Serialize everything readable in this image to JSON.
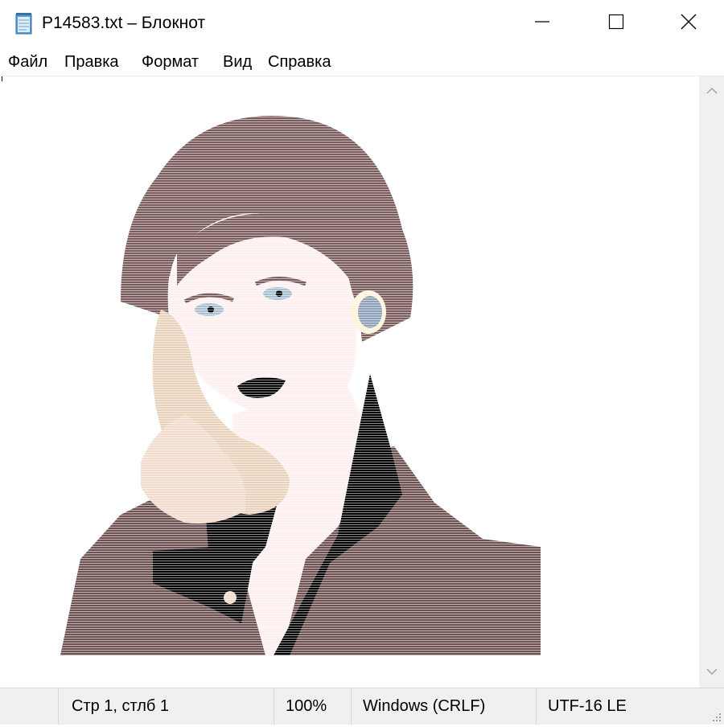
{
  "window": {
    "title": "P14583.txt – Блокнот",
    "icon": "notepad-icon"
  },
  "menu": {
    "items": [
      "Файл",
      "Правка",
      "Формат",
      "Вид",
      "Справка"
    ]
  },
  "editor": {
    "content": "ASCII-art illustration of a woman talking on a telephone",
    "colors": {
      "hair": "#7b5c5c",
      "skin": "#fff0f0",
      "phone": "#e8d2bb",
      "jacket": "#6e5252",
      "collar": "#000000",
      "earring": "#8ea0b8"
    }
  },
  "status": {
    "position": "Стр 1, стлб 1",
    "zoom": "100%",
    "line_endings": "Windows (CRLF)",
    "encoding": "UTF-16 LE"
  }
}
